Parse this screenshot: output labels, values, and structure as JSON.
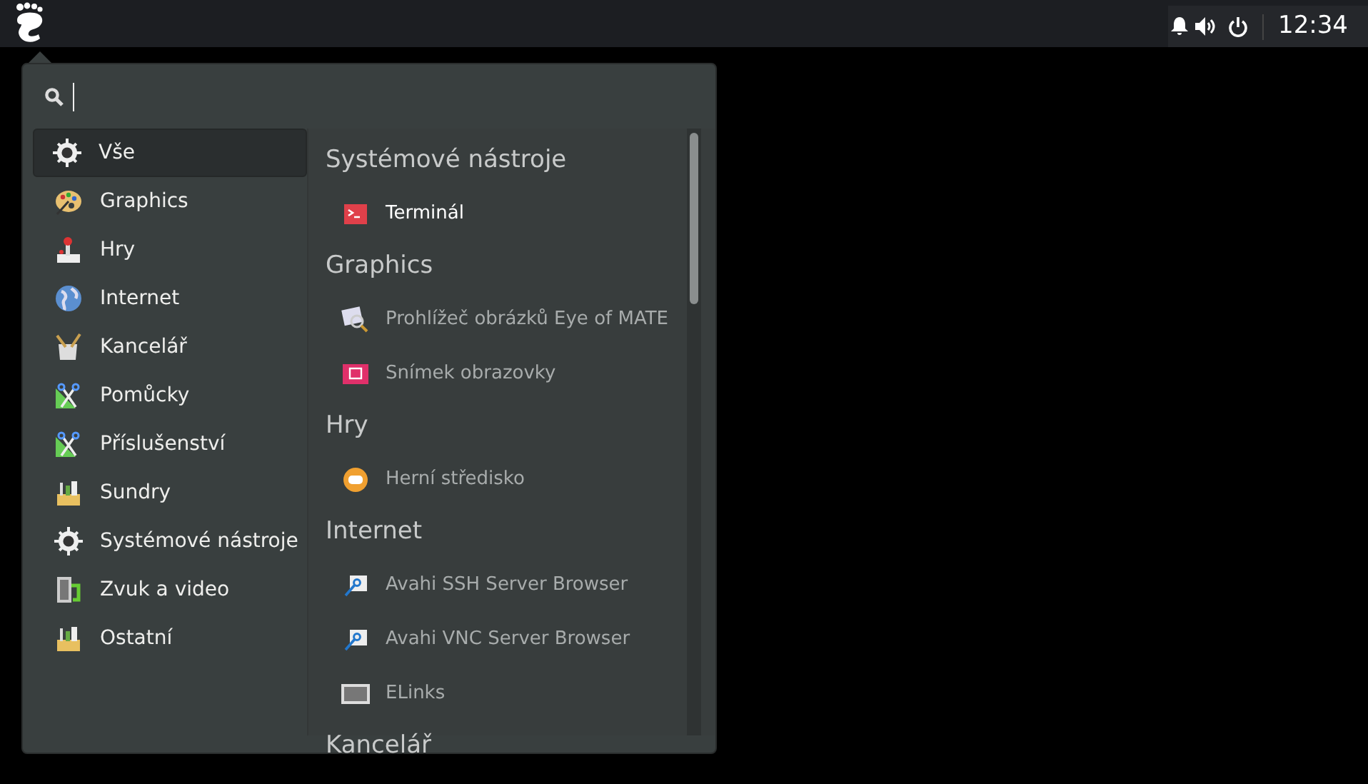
{
  "top_bar": {
    "clock": "12:34"
  },
  "categories": [
    {
      "label": "Vše",
      "selected": true
    },
    {
      "label": "Graphics",
      "selected": false
    },
    {
      "label": "Hry",
      "selected": false
    },
    {
      "label": "Internet",
      "selected": false
    },
    {
      "label": "Kancelář",
      "selected": false
    },
    {
      "label": "Pomůcky",
      "selected": false
    },
    {
      "label": "Příslušenství",
      "selected": false
    },
    {
      "label": "Sundry",
      "selected": false
    },
    {
      "label": "Systémové nástroje",
      "selected": false
    },
    {
      "label": "Zvuk a video",
      "selected": false
    },
    {
      "label": "Ostatní",
      "selected": false
    }
  ],
  "sections": [
    {
      "title": "Systémové nástroje",
      "apps": [
        {
          "label": "Terminál",
          "hovered": true
        }
      ]
    },
    {
      "title": "Graphics",
      "apps": [
        {
          "label": "Prohlížeč obrázků Eye of MATE",
          "hovered": false
        },
        {
          "label": "Snímek obrazovky",
          "hovered": false
        }
      ]
    },
    {
      "title": "Hry",
      "apps": [
        {
          "label": "Herní středisko",
          "hovered": false
        }
      ]
    },
    {
      "title": "Internet",
      "apps": [
        {
          "label": "Avahi SSH Server Browser",
          "hovered": false
        },
        {
          "label": "Avahi VNC Server Browser",
          "hovered": false
        },
        {
          "label": "ELinks",
          "hovered": false
        }
      ]
    },
    {
      "title": "Kancelář"
    }
  ]
}
